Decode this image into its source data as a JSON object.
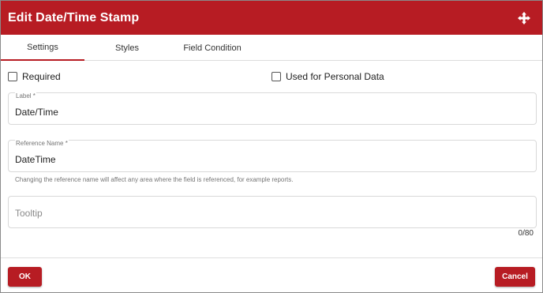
{
  "dialog": {
    "title": "Edit Date/Time Stamp",
    "accent_color": "#b71c23",
    "move_icon": "move-arrows-icon"
  },
  "tabs": [
    {
      "label": "Settings",
      "active": true
    },
    {
      "label": "Styles",
      "active": false
    },
    {
      "label": "Field Condition",
      "active": false
    }
  ],
  "checkboxes": {
    "required": {
      "label": "Required",
      "checked": false
    },
    "personal_data": {
      "label": "Used for Personal Data",
      "checked": false
    }
  },
  "fields": {
    "label": {
      "label": "Label *",
      "value": "Date/Time"
    },
    "reference_name": {
      "label": "Reference Name *",
      "value": "DateTime",
      "hint": "Changing the reference name will affect any area where the field is referenced, for example reports."
    },
    "tooltip": {
      "placeholder": "Tooltip",
      "value": "",
      "counter": "0/80"
    }
  },
  "footer": {
    "ok_label": "OK",
    "cancel_label": "Cancel"
  }
}
